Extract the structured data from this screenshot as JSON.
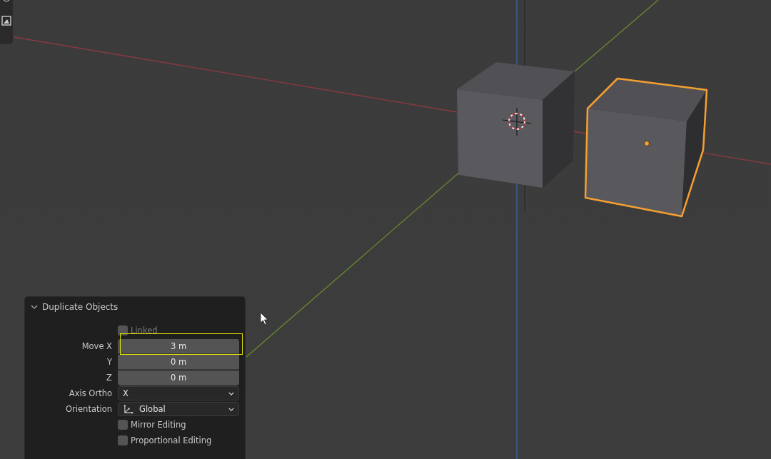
{
  "panel": {
    "title": "Duplicate Objects",
    "expanded": true,
    "rows": [
      {
        "kind": "checkbox",
        "label": "Linked",
        "checked": false,
        "disabled": true
      },
      {
        "kind": "number",
        "label": "Move X",
        "value": "3 m",
        "highlighted": true
      },
      {
        "kind": "number",
        "label": "Y",
        "value": "0 m",
        "highlighted": false
      },
      {
        "kind": "number",
        "label": "Z",
        "value": "0 m",
        "highlighted": false
      },
      {
        "kind": "dropdown",
        "label": "Axis Ortho",
        "value": "X",
        "icon": false
      },
      {
        "kind": "dropdown",
        "label": "Orientation",
        "value": "Global",
        "icon": true
      },
      {
        "kind": "checkbox",
        "label": "Mirror Editing",
        "checked": false,
        "disabled": false
      },
      {
        "kind": "checkbox",
        "label": "Proportional Editing",
        "checked": false,
        "disabled": false
      }
    ]
  }
}
